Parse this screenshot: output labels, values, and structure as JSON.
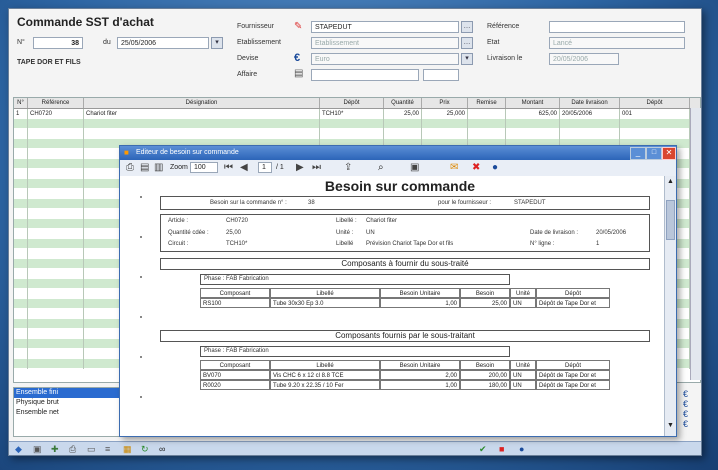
{
  "form": {
    "title": "Commande SST d'achat",
    "num_label": "N°",
    "num_value": "38",
    "du_label": "du",
    "date_value": "25/05/2006",
    "company": "TAPE DOR ET FILS",
    "fournisseur_label": "Fournisseur",
    "fournisseur_value": "STAPEDUT",
    "etablissement_label": "Etablissement",
    "etablissement_value": "Etablissement",
    "devise_label": "Devise",
    "devise_value": "Euro",
    "affaire_label": "Affaire",
    "reference_label": "Référence",
    "etat_label": "Etat",
    "etat_value": "Lancé",
    "livraison_label": "Livraison le",
    "livraison_value": "20/05/2006"
  },
  "grid": {
    "columns": [
      "N°",
      "Référence",
      "Désignation",
      "Dépôt",
      "Quantité",
      "Prix",
      "Remise",
      "Montant",
      "Date livraison",
      "Dépôt"
    ],
    "rows": [
      [
        "1",
        "CH0720",
        "Chariot fiter",
        "TCH10*",
        "25,00",
        "25,000",
        "",
        "625,00",
        "20/05/2006",
        "001"
      ]
    ],
    "row_count": 26
  },
  "sidebar_list": {
    "items": [
      "Ensemble fini",
      "Physique brut",
      "Ensemble net"
    ],
    "selected_index": 0
  },
  "popup": {
    "title": "Editeur de besoin sur commande",
    "zoom_label": "Zoom",
    "zoom_value": "100",
    "page_value": "1",
    "page_total": "/ 1",
    "doc": {
      "heading": "Besoin sur commande",
      "besoin_label": "Besoin sur la commande n° :",
      "besoin_value": "38",
      "fournisseur_label": "pour le fournisseur :",
      "fournisseur_value": "STAPEDUT",
      "article_label": "Article :",
      "article_value": "CH0720",
      "libelle_label": "Libellé :",
      "libelle_value": "Chariot fiter",
      "quantite_label": "Quantité cdée :",
      "quantite_value": "25,00",
      "unite_label": "Unité :",
      "unite_value": "UN",
      "date_label": "Date de livraison :",
      "date_value": "20/05/2006",
      "circuit_label": "Circuit :",
      "circuit_value": "TCH10*",
      "depot_label": "Libellé",
      "depot_value": "Prévision Chariot Tape Dor et fils",
      "origine_label": "N° ligne :",
      "origine_value": "1",
      "section1": "Composants à fournir du sous-traité",
      "phase1": "Phase : FAB  Fabrication",
      "table1_headers": [
        "Composant",
        "Libellé",
        "Besoin Unitaire",
        "Besoin",
        "Unité",
        "Dépôt"
      ],
      "table1_rows": [
        [
          "RS100",
          "Tube 30x30 Ep 3.0",
          "1,00",
          "25,00",
          "UN",
          "Dépôt de Tape Dor et"
        ]
      ],
      "section2": "Composants fournis par le sous-traitant",
      "phase2": "Phase : FAB  Fabrication",
      "table2_headers": [
        "Composant",
        "Libellé",
        "Besoin Unitaire",
        "Besoin",
        "Unité",
        "Dépôt"
      ],
      "table2_rows": [
        [
          "BV070",
          "Vis CHC 6 x 12 cl 8.8 TCE",
          "2,00",
          "200,00",
          "UN",
          "Dépôt de Tape Dor et"
        ],
        [
          "R0020",
          "Tube 9.20 x 22.35 / 10 Fer",
          "1,00",
          "180,00",
          "UN",
          "Dépôt de Tape Dor et"
        ]
      ]
    }
  },
  "colors": {
    "accent": "#2c64b8",
    "row_green": "#cfe9cf",
    "background": "#1c4f86"
  }
}
